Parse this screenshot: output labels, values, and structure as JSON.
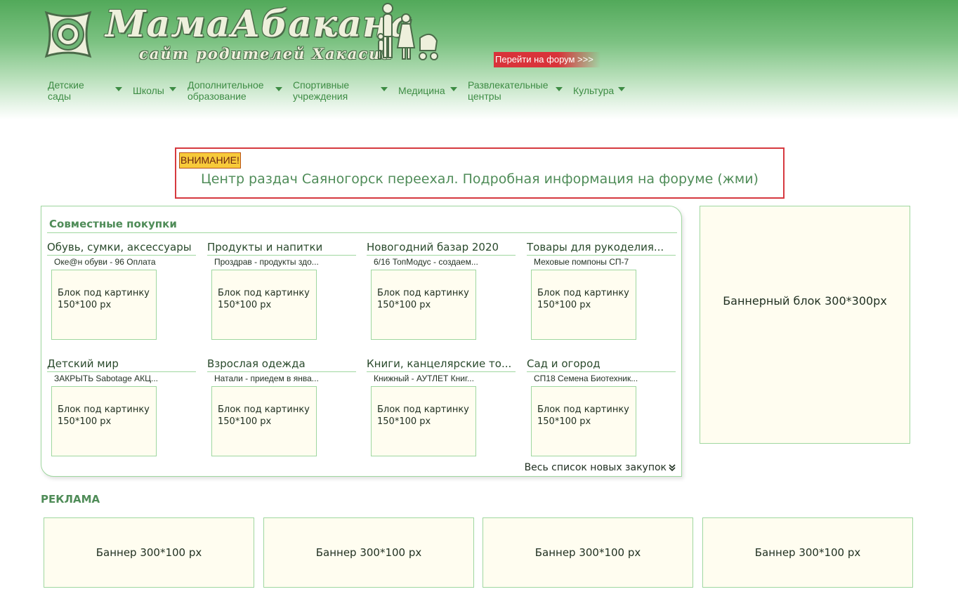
{
  "site": {
    "title": "МамаАбакана",
    "subtitle": "сайт родителей Хакасии",
    "forum_link": "Перейти на форум >>>"
  },
  "nav": [
    {
      "label": "Детские сады",
      "icon": "caret-down-icon"
    },
    {
      "label": "Школы",
      "icon": "caret-down-icon"
    },
    {
      "label": "Дополнительное образование",
      "icon": "caret-down-icon"
    },
    {
      "label": "Спортивные учреждения",
      "icon": "caret-down-icon"
    },
    {
      "label": "Медицина",
      "icon": "caret-down-icon"
    },
    {
      "label": "Развлекательные центры",
      "icon": "caret-down-icon"
    },
    {
      "label": "Культура",
      "icon": "caret-down-icon"
    }
  ],
  "alert": {
    "badge": "ВНИМАНИЕ!",
    "text": "Центр раздач Саяногорск переехал. Подробная информация на форуме (жми)"
  },
  "joint_purchases": {
    "title": "Совместные покупки",
    "categories": [
      {
        "title": "Обувь, сумки, аксессуары",
        "item": "Оке@н обуви - 96 Оплата",
        "image_text": "Блок под картинку 150*100 px"
      },
      {
        "title": "Продукты и напитки",
        "item": "Проздрав - продукты здо...",
        "image_text": "Блок под картинку 150*100 px"
      },
      {
        "title": "Новогодний базар 2020",
        "item": "6/16 ТопМодус - создаем...",
        "image_text": "Блок под картинку 150*100 px"
      },
      {
        "title": "Товары для рукоделия...",
        "item": "Меховые помпоны СП-7",
        "image_text": "Блок под картинку 150*100 px"
      },
      {
        "title": "Детский мир",
        "item": "ЗАКРЫТЬ Sabotage АКЦ...",
        "image_text": "Блок под картинку 150*100 px"
      },
      {
        "title": "Взрослая одежда",
        "item": "Натали - приедем в янва...",
        "image_text": "Блок под картинку 150*100 px"
      },
      {
        "title": "Книги, канцелярские то...",
        "item": "Книжный - АУТЛЕТ Книг...",
        "image_text": "Блок под картинку 150*100 px"
      },
      {
        "title": "Сад и огород",
        "item": "СП18 Семена Биотехник...",
        "image_text": "Блок под картинку 150*100 px"
      }
    ],
    "all_link": "Весь список новых закупок"
  },
  "big_banner": "Баннерный блок 300*300px",
  "ads": {
    "title": "РЕКЛАМА",
    "banners": [
      "Баннер 300*100 px",
      "Баннер 300*100 px",
      "Баннер 300*100 px",
      "Баннер 300*100 px"
    ]
  },
  "colors": {
    "brand_green": "#52a95a",
    "link_green": "#3d8c44",
    "alert_red": "#d6393f",
    "badge_yellow": "#f7ca3a",
    "block_bg": "#fffdf0",
    "block_border": "#9fd79f"
  }
}
